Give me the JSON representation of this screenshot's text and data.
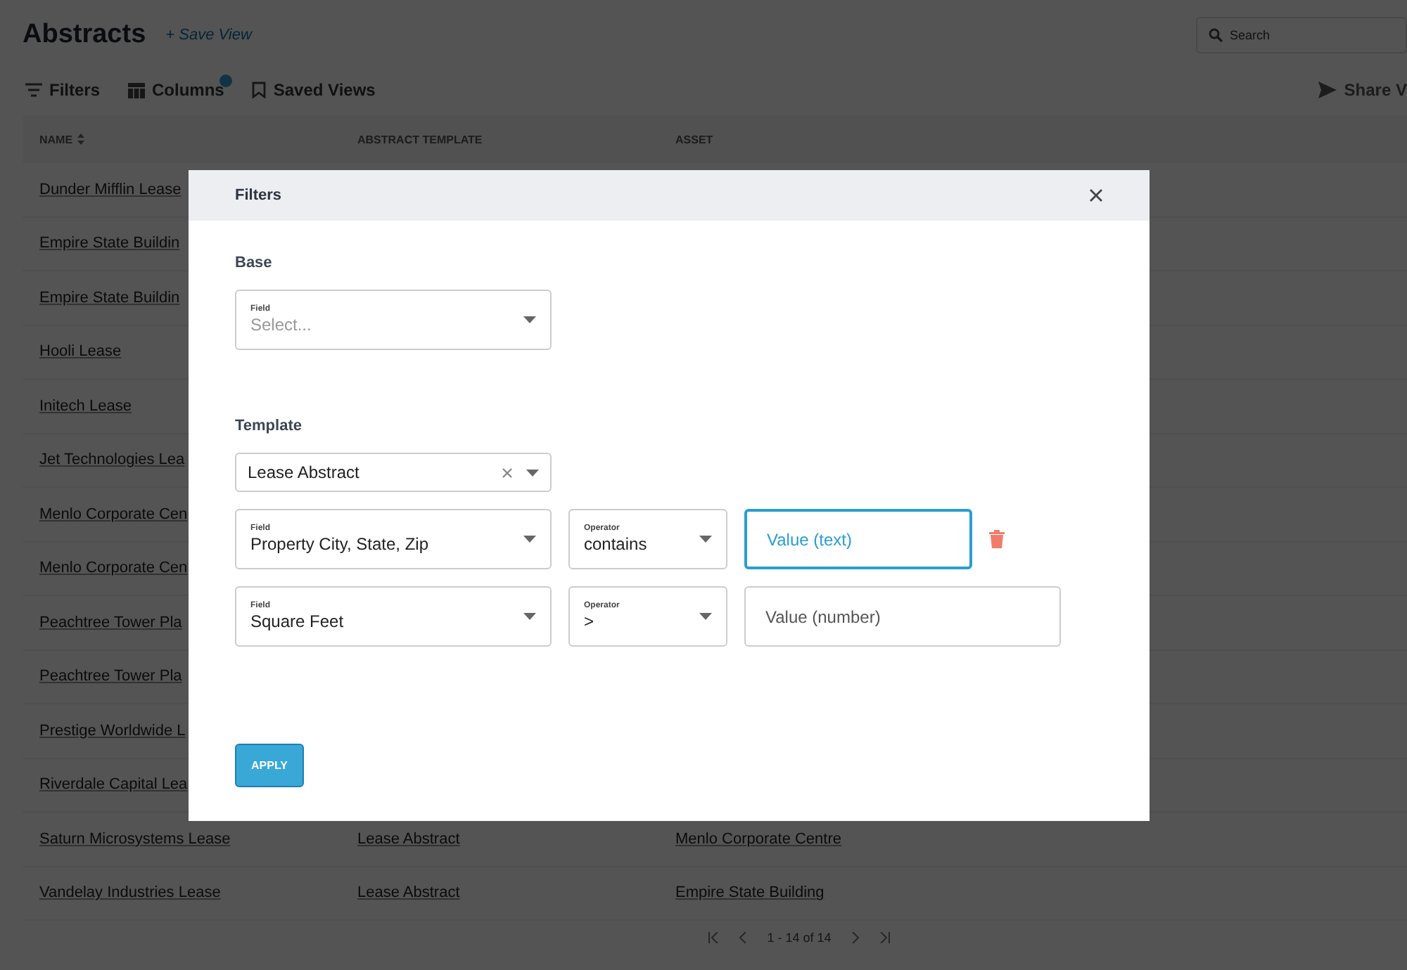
{
  "page": {
    "title": "Abstracts",
    "save_view": "+ Save View",
    "search": {
      "placeholder": "Search"
    },
    "toolbar": [
      {
        "kind": "filters",
        "label": "Filters",
        "badge": false
      },
      {
        "kind": "columns",
        "label": "Columns",
        "badge": true
      },
      {
        "kind": "saved",
        "label": "Saved Views",
        "badge": false
      }
    ],
    "share": "Share V",
    "columns": [
      "NAME",
      "ABSTRACT TEMPLATE",
      "ASSET"
    ],
    "rows": [
      {
        "name": "Dunder Mifflin Lease"
      },
      {
        "name": "Empire State Buildin"
      },
      {
        "name": "Empire State Buildin"
      },
      {
        "name": "Hooli Lease"
      },
      {
        "name": "Initech Lease"
      },
      {
        "name": "Jet Technologies Lea"
      },
      {
        "name": "Menlo Corporate Cen"
      },
      {
        "name": "Menlo Corporate Cen"
      },
      {
        "name": "Peachtree Tower Pla"
      },
      {
        "name": "Peachtree Tower Pla"
      },
      {
        "name": "Prestige Worldwide L"
      },
      {
        "name": "Riverdale Capital Lea"
      },
      {
        "name": "Saturn Microsystems Lease",
        "template": "Lease Abstract",
        "asset": "Menlo Corporate Centre"
      },
      {
        "name": "Vandelay Industries Lease",
        "template": "Lease Abstract",
        "asset": "Empire State Building"
      }
    ],
    "pager": "1 - 14 of 14"
  },
  "modal": {
    "title": "Filters",
    "base": {
      "heading": "Base",
      "field": {
        "label": "Field",
        "placeholder": "Select..."
      }
    },
    "template": {
      "heading": "Template",
      "select": {
        "value": "Lease Abstract",
        "clearable": true
      },
      "conditions": [
        {
          "field_label": "Field",
          "field": "Property City, State, Zip",
          "operator_label": "Operator",
          "operator": "contains",
          "value_placeholder": "Value (text)",
          "focused": true,
          "show_delete": true
        },
        {
          "field_label": "Field",
          "field": "Square Feet",
          "operator_label": "Operator",
          "operator": ">",
          "value_placeholder": "Value (number)",
          "focused": false,
          "show_delete": false
        }
      ]
    },
    "apply": "APPLY"
  }
}
